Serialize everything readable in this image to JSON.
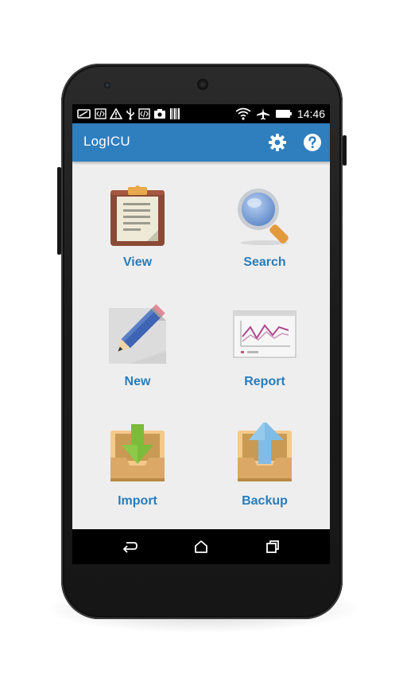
{
  "app": {
    "title": "LogICU"
  },
  "status_bar": {
    "time": "14:46",
    "left_icons": [
      "battery-saver-icon",
      "code-icon",
      "warning-icon",
      "usb-icon",
      "code-icon",
      "screenshot-icon",
      "barcode-icon"
    ],
    "right_icons": [
      "wifi-icon",
      "airplane-mode-icon",
      "battery-icon"
    ]
  },
  "toolbar": {
    "settings_icon": "gear-icon",
    "help_icon": "help-icon"
  },
  "menu": [
    {
      "id": "view",
      "label": "View",
      "icon": "clipboard-icon"
    },
    {
      "id": "search",
      "label": "Search",
      "icon": "magnifier-icon"
    },
    {
      "id": "new",
      "label": "New",
      "icon": "pencil-note-icon"
    },
    {
      "id": "report",
      "label": "Report",
      "icon": "chart-report-icon"
    },
    {
      "id": "import",
      "label": "Import",
      "icon": "import-tray-icon"
    },
    {
      "id": "backup",
      "label": "Backup",
      "icon": "backup-tray-icon"
    }
  ],
  "nav_bar": {
    "buttons": [
      "back-icon",
      "home-icon",
      "recents-icon"
    ]
  },
  "colors": {
    "app_bar": "#2f7fbf",
    "label_text": "#2a7cb8",
    "content_bg": "#eeeeee"
  }
}
